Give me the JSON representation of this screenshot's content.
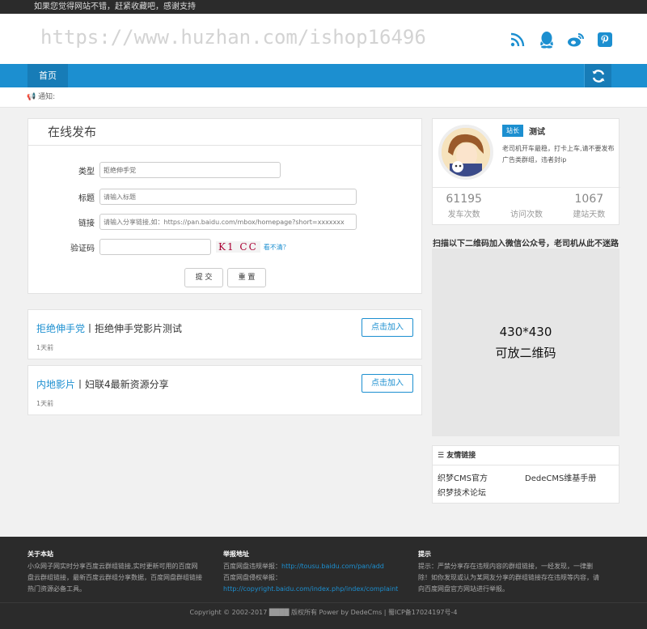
{
  "topbar": {
    "text": "如果您觉得网站不错，赶紧收藏吧，感谢支持"
  },
  "watermark": "https://www.huzhan.com/ishop16496",
  "socials": [
    "rss-icon",
    "qq-icon",
    "weibo-icon",
    "pinterest-icon"
  ],
  "nav": {
    "home": "首页"
  },
  "notice": {
    "label": "通知:"
  },
  "form": {
    "title": "在线发布",
    "type_label": "类型",
    "type_value": "拒绝伸手党",
    "title_label": "标题",
    "title_placeholder": "请输入标题",
    "link_label": "链接",
    "link_placeholder": "请输入分享链接,如：https://pan.baidu.com/mbox/homepage?short=xxxxxxx",
    "captcha_label": "验证码",
    "captcha_image_text": "K1 CC",
    "captcha_refresh": "看不清？",
    "submit": "提 交",
    "reset": "重 置"
  },
  "items": [
    {
      "category": "拒绝伸手党",
      "title": "拒绝伸手党影片测试",
      "time": "1天前",
      "button": "点击加入"
    },
    {
      "category": "内地影片",
      "title": "妇联4最新资源分享",
      "time": "1天前",
      "button": "点击加入"
    }
  ],
  "profile": {
    "role": "站长",
    "name": "测试",
    "desc": "老司机开车最稳，打卡上车,请不要发布广告类群组，违者封ip",
    "stats": [
      {
        "value": "61195",
        "label": "发车次数"
      },
      {
        "value": "",
        "label": "访问次数"
      },
      {
        "value": "1067",
        "label": "建站天数"
      }
    ]
  },
  "qr": {
    "title": "扫描以下二维码加入微信公众号，老司机从此不迷路",
    "size": "430*430",
    "caption": "可放二维码"
  },
  "links": {
    "title": "友情链接",
    "items": [
      "织梦CMS官方",
      "DedeCMS维基手册",
      "织梦技术论坛"
    ]
  },
  "footer": {
    "about_title": "关于本站",
    "about_text": "小众网子网实时分享百度云群组链接,实时更新可用的百度网盘云群组链接，最新百度云群组分享数据，百度网盘群组链接热门资源必备工具。",
    "report_title": "举报地址",
    "report_line1_label": "百度网盘违规举报：",
    "report_line1_link": "http://tousu.baidu.com/pan/add",
    "report_line2_label": "百度网盘侵权举报：",
    "report_line2_link": "http://copyright.baidu.com/index.php/index/complaint",
    "tip_title": "提示",
    "tip_text": "提示：严禁分享存在违规内容的群组链接，一经发现，一律删除！如你发现或认为某网友分享的群组链接存在违规等内容，请向百度网盘官方网站进行举报。",
    "copyright": "Copyright © 2002-2017 ████ 版权所有 Power by DedeCms | 蜀ICP备17024197号-4"
  },
  "colors": {
    "accent": "#1c8fd0",
    "dark": "#2b2b2b"
  }
}
